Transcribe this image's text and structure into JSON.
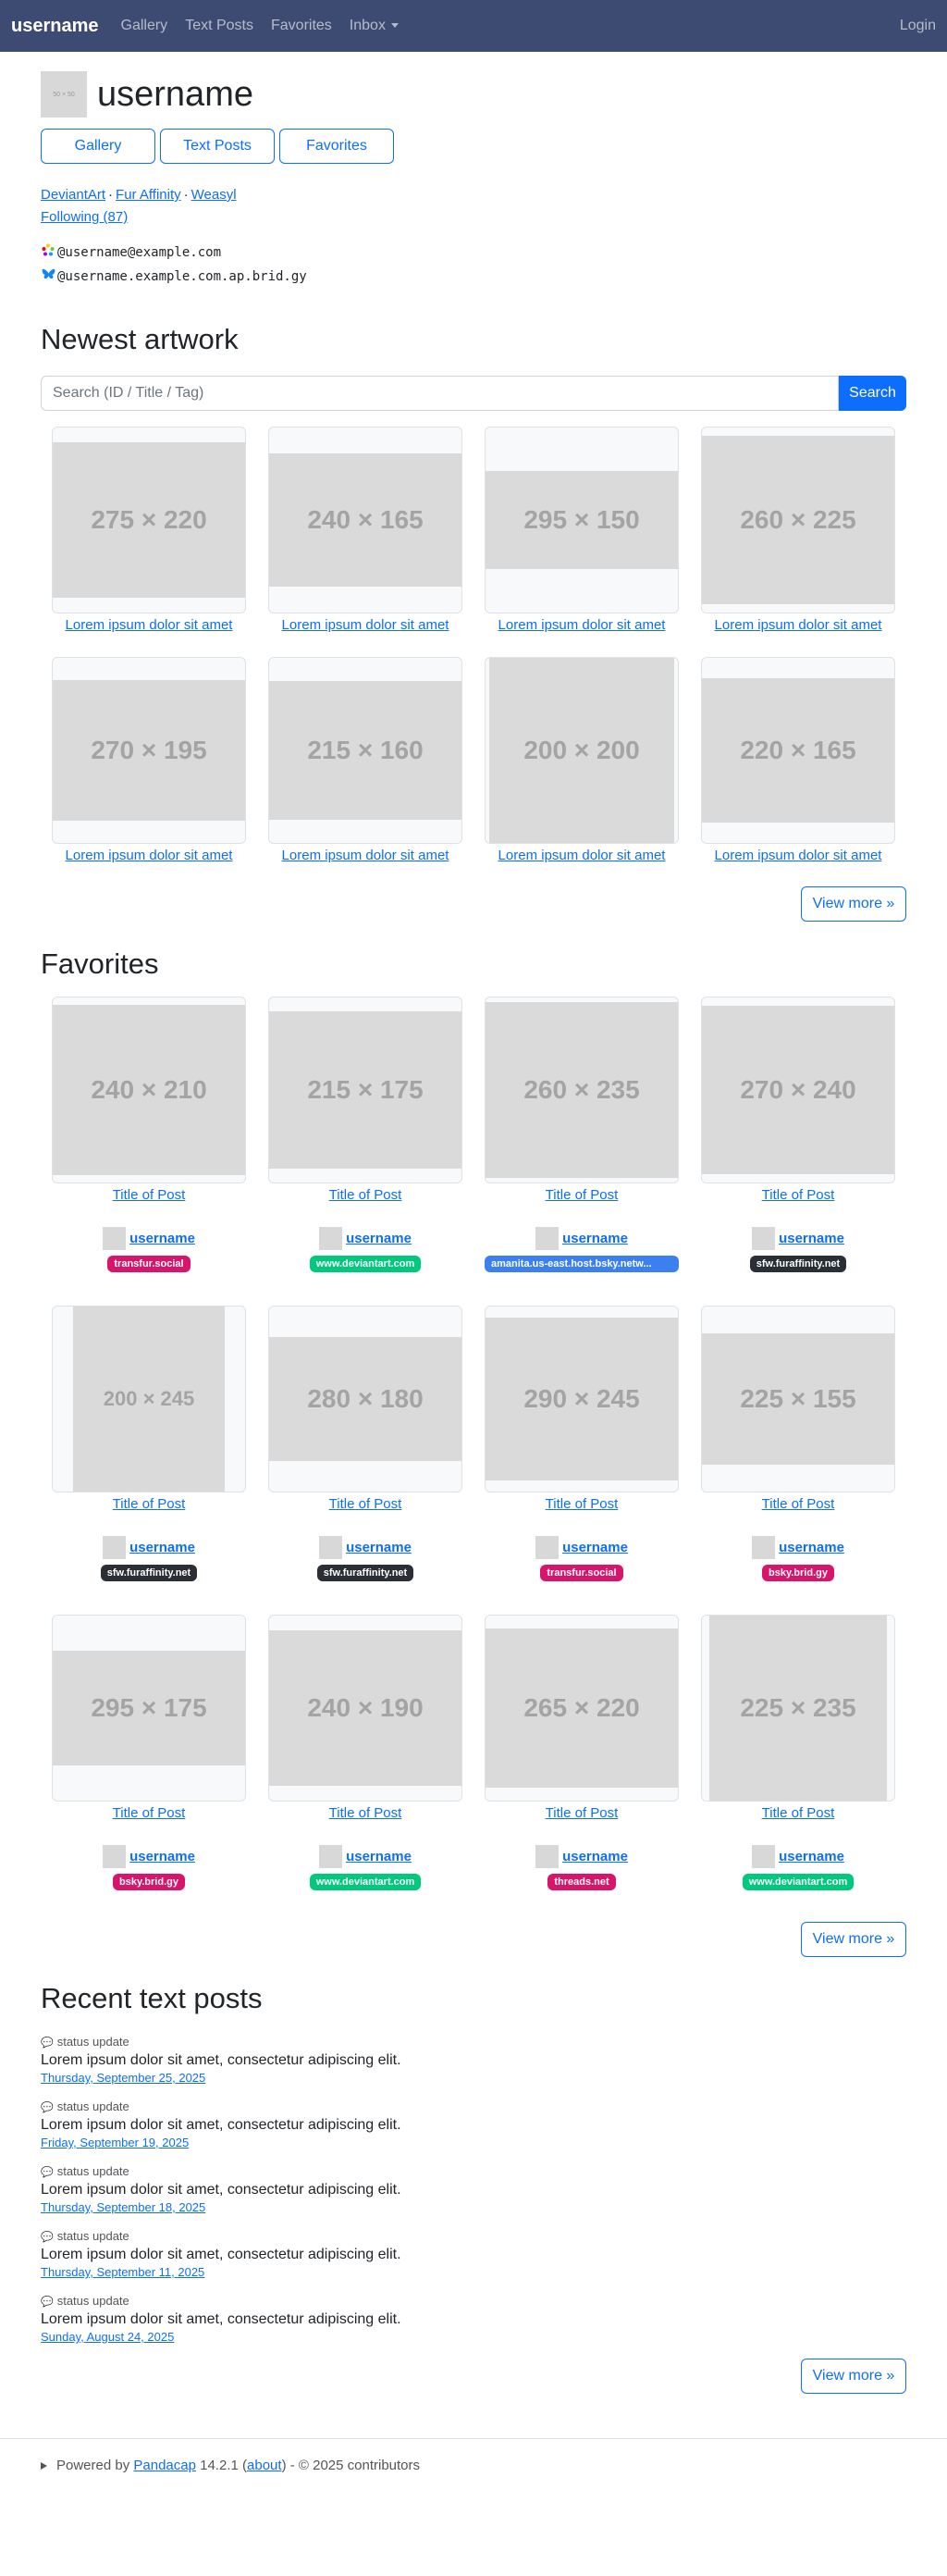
{
  "nav": {
    "brand": "username",
    "links": [
      "Gallery",
      "Text Posts",
      "Favorites",
      "Inbox"
    ],
    "login": "Login"
  },
  "profile": {
    "avatar_label": "50 × 50",
    "name": "username",
    "buttons": [
      "Gallery",
      "Text Posts",
      "Favorites"
    ],
    "external_links": [
      "DeviantArt",
      "Fur Affinity",
      "Weasyl"
    ],
    "following": "Following (87)",
    "handles": [
      {
        "icon": "fediverse-icon",
        "text": "@username@example.com"
      },
      {
        "icon": "bluesky-butterfly-icon",
        "text": "@username.example.com.ap.brid.gy"
      }
    ]
  },
  "artwork": {
    "heading": "Newest artwork",
    "search_placeholder": "Search (ID / Title / Tag)",
    "search_button": "Search",
    "items": [
      {
        "label": "275 × 220",
        "title": "Lorem ipsum dolor sit amet"
      },
      {
        "label": "240 × 165",
        "title": "Lorem ipsum dolor sit amet"
      },
      {
        "label": "295 × 150",
        "title": "Lorem ipsum dolor sit amet"
      },
      {
        "label": "260 × 225",
        "title": "Lorem ipsum dolor sit amet"
      },
      {
        "label": "270 × 195",
        "title": "Lorem ipsum dolor sit amet"
      },
      {
        "label": "215 × 160",
        "title": "Lorem ipsum dolor sit amet"
      },
      {
        "label": "200 × 200",
        "title": "Lorem ipsum dolor sit amet"
      },
      {
        "label": "220 × 165",
        "title": "Lorem ipsum dolor sit amet"
      }
    ],
    "view_more": "View more »"
  },
  "favorites": {
    "heading": "Favorites",
    "avatar_label": "25 × 25",
    "items": [
      {
        "label": "240 × 210",
        "title": "Title of Post",
        "user": "username",
        "host": "transfur.social",
        "host_color": "#d6156b"
      },
      {
        "label": "215 × 175",
        "title": "Title of Post",
        "user": "username",
        "host": "www.deviantart.com",
        "host_color": "#00c87c"
      },
      {
        "label": "260 × 235",
        "title": "Title of Post",
        "user": "username",
        "host": "amanita.us-east.host.bsky.netw...",
        "host_color": "#3b7ff0"
      },
      {
        "label": "270 × 240",
        "title": "Title of Post",
        "user": "username",
        "host": "sfw.furaffinity.net",
        "host_color": "#2a2f36"
      },
      {
        "label": "200 × 245",
        "title": "Title of Post",
        "user": "username",
        "host": "sfw.furaffinity.net",
        "host_color": "#2a2f36"
      },
      {
        "label": "280 × 180",
        "title": "Title of Post",
        "user": "username",
        "host": "sfw.furaffinity.net",
        "host_color": "#2a2f36"
      },
      {
        "label": "290 × 245",
        "title": "Title of Post",
        "user": "username",
        "host": "transfur.social",
        "host_color": "#d6156b"
      },
      {
        "label": "225 × 155",
        "title": "Title of Post",
        "user": "username",
        "host": "bsky.brid.gy",
        "host_color": "#d6156b"
      },
      {
        "label": "295 × 175",
        "title": "Title of Post",
        "user": "username",
        "host": "bsky.brid.gy",
        "host_color": "#d6156b"
      },
      {
        "label": "240 × 190",
        "title": "Title of Post",
        "user": "username",
        "host": "www.deviantart.com",
        "host_color": "#00c87c"
      },
      {
        "label": "265 × 220",
        "title": "Title of Post",
        "user": "username",
        "host": "threads.net",
        "host_color": "#d6156b"
      },
      {
        "label": "225 × 235",
        "title": "Title of Post",
        "user": "username",
        "host": "www.deviantart.com",
        "host_color": "#00c87c"
      }
    ],
    "view_more": "View more »"
  },
  "text_posts": {
    "heading": "Recent text posts",
    "items": [
      {
        "type": "status update",
        "body": "Lorem ipsum dolor sit amet, consectetur adipiscing elit.",
        "date": "Thursday, September 25, 2025"
      },
      {
        "type": "status update",
        "body": "Lorem ipsum dolor sit amet, consectetur adipiscing elit.",
        "date": "Friday, September 19, 2025"
      },
      {
        "type": "status update",
        "body": "Lorem ipsum dolor sit amet, consectetur adipiscing elit.",
        "date": "Thursday, September 18, 2025"
      },
      {
        "type": "status update",
        "body": "Lorem ipsum dolor sit amet, consectetur adipiscing elit.",
        "date": "Thursday, September 11, 2025"
      },
      {
        "type": "status update",
        "body": "Lorem ipsum dolor sit amet, consectetur adipiscing elit.",
        "date": "Sunday, August 24, 2025"
      }
    ],
    "view_more": "View more »"
  },
  "footer": {
    "prefix": "Powered by",
    "app_name": "Pandacap",
    "version": "14.2.1",
    "about": "about",
    "copyright": "- © 2025 contributors"
  }
}
